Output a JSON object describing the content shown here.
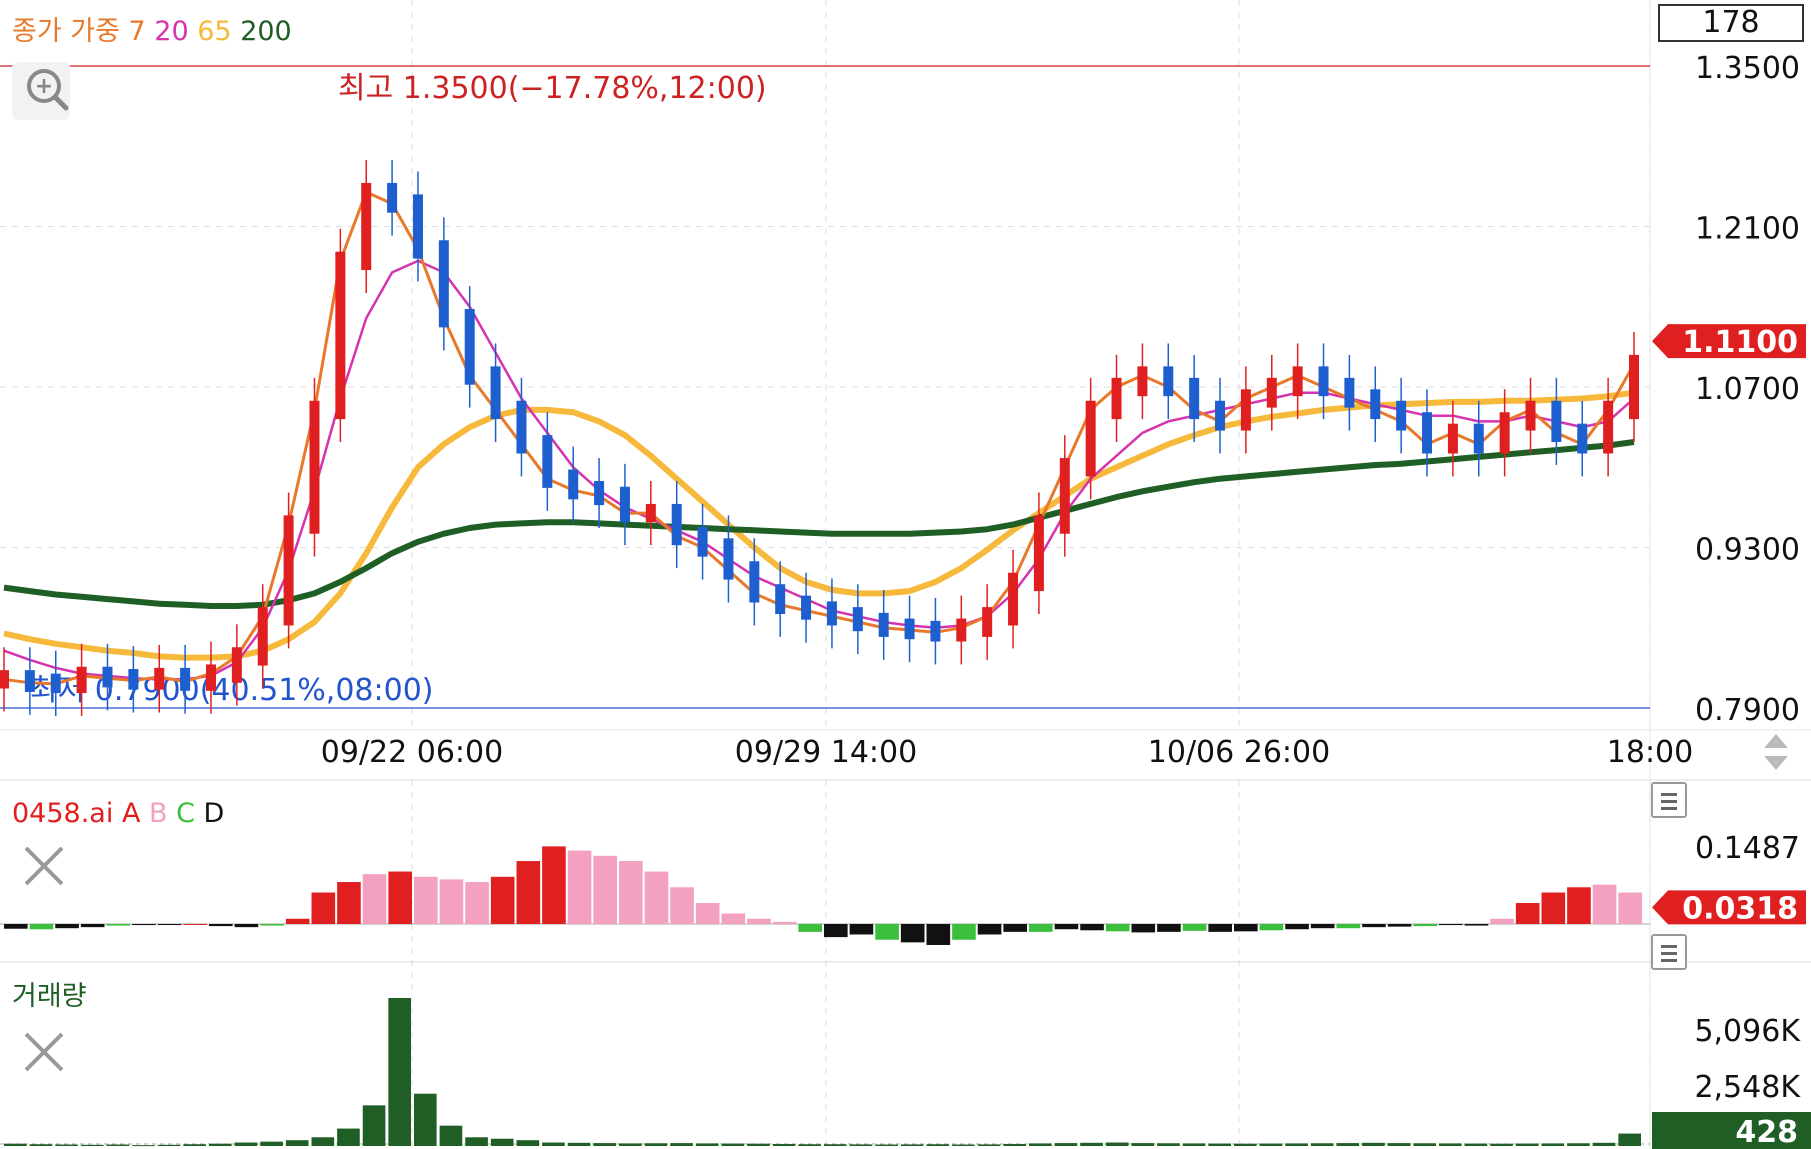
{
  "legend": {
    "prefix": "종가 가중",
    "ma": [
      {
        "label": "7",
        "color": "#e8792a"
      },
      {
        "label": "20",
        "color": "#d633b0"
      },
      {
        "label": "65",
        "color": "#f6b93b"
      },
      {
        "label": "200",
        "color": "#1f5e25"
      }
    ]
  },
  "counter": "178",
  "colors": {
    "up": "#e02020",
    "down": "#1e5fd0",
    "ma7": "#e8792a",
    "ma20": "#d633b0",
    "ma65": "#f6b93b",
    "ma200": "#1f5e25",
    "indicator_green": "#3cbf3c",
    "indicator_pink": "#f4a0c0",
    "volume": "#1f5e25"
  },
  "annotations": {
    "high": "최고 1.3500(−17.78%,12:00)",
    "low": "최저 0.7900(40.51%,08:00)"
  },
  "price_axis": [
    "1.3500",
    "1.2100",
    "1.0700",
    "0.9300",
    "0.7900"
  ],
  "current_price": "1.1100",
  "time_axis": [
    "09/22 06:00",
    "09/29 14:00",
    "10/06 26:00",
    "18:00"
  ],
  "indicator": {
    "name": "0458.ai",
    "lines": [
      {
        "label": "A",
        "color": "#e02020"
      },
      {
        "label": "B",
        "color": "#f4a0c0"
      },
      {
        "label": "C",
        "color": "#3cbf3c"
      },
      {
        "label": "D",
        "color": "#111111"
      }
    ],
    "axis": [
      "0.1487"
    ],
    "current": "0.0318"
  },
  "volume": {
    "title": "거래량",
    "axis": [
      "5,096K",
      "2,548K"
    ],
    "current": "428"
  },
  "chart_data": [
    {
      "type": "candlestick",
      "title": "",
      "ylim": [
        0.79,
        1.35
      ],
      "x_ticks": [
        "09/22 06:00",
        "09/29 14:00",
        "10/06 26:00",
        "18:00"
      ],
      "series": [
        {
          "name": "7",
          "type": "line",
          "values": [
            0.815,
            0.812,
            0.811,
            0.818,
            0.816,
            0.814,
            0.817,
            0.813,
            0.82,
            0.835,
            0.87,
            0.95,
            1.05,
            1.18,
            1.24,
            1.23,
            1.19,
            1.13,
            1.08,
            1.05,
            1.02,
            0.99,
            0.98,
            0.975,
            0.96,
            0.96,
            0.94,
            0.93,
            0.91,
            0.89,
            0.88,
            0.875,
            0.87,
            0.865,
            0.86,
            0.858,
            0.856,
            0.86,
            0.87,
            0.9,
            0.95,
            1.0,
            1.05,
            1.07,
            1.08,
            1.07,
            1.05,
            1.04,
            1.06,
            1.07,
            1.08,
            1.07,
            1.06,
            1.05,
            1.04,
            1.02,
            1.03,
            1.02,
            1.04,
            1.05,
            1.03,
            1.02,
            1.05,
            1.09
          ]
        },
        {
          "name": "20",
          "type": "line",
          "values": [
            0.84,
            0.832,
            0.825,
            0.82,
            0.818,
            0.816,
            0.815,
            0.815,
            0.818,
            0.83,
            0.86,
            0.91,
            0.98,
            1.06,
            1.13,
            1.17,
            1.18,
            1.17,
            1.14,
            1.1,
            1.06,
            1.03,
            1.0,
            0.98,
            0.965,
            0.955,
            0.945,
            0.935,
            0.92,
            0.905,
            0.895,
            0.885,
            0.875,
            0.87,
            0.865,
            0.862,
            0.86,
            0.862,
            0.87,
            0.89,
            0.92,
            0.96,
            0.99,
            1.01,
            1.03,
            1.04,
            1.045,
            1.05,
            1.055,
            1.06,
            1.065,
            1.065,
            1.06,
            1.055,
            1.05,
            1.045,
            1.045,
            1.04,
            1.04,
            1.045,
            1.04,
            1.035,
            1.04,
            1.06
          ]
        },
        {
          "name": "65",
          "type": "line",
          "values": [
            0.855,
            0.85,
            0.846,
            0.843,
            0.84,
            0.838,
            0.835,
            0.834,
            0.834,
            0.835,
            0.84,
            0.85,
            0.865,
            0.89,
            0.925,
            0.965,
            1.0,
            1.02,
            1.035,
            1.045,
            1.05,
            1.05,
            1.048,
            1.04,
            1.028,
            1.01,
            0.99,
            0.97,
            0.95,
            0.93,
            0.912,
            0.9,
            0.893,
            0.89,
            0.89,
            0.892,
            0.9,
            0.912,
            0.928,
            0.945,
            0.96,
            0.975,
            0.99,
            1.0,
            1.01,
            1.02,
            1.028,
            1.035,
            1.04,
            1.044,
            1.047,
            1.05,
            1.052,
            1.054,
            1.055,
            1.056,
            1.057,
            1.057,
            1.058,
            1.058,
            1.059,
            1.06,
            1.062,
            1.065
          ]
        },
        {
          "name": "200",
          "type": "line",
          "values": [
            0.895,
            0.892,
            0.889,
            0.887,
            0.885,
            0.883,
            0.881,
            0.88,
            0.879,
            0.879,
            0.88,
            0.884,
            0.89,
            0.9,
            0.912,
            0.925,
            0.935,
            0.942,
            0.947,
            0.95,
            0.951,
            0.952,
            0.952,
            0.951,
            0.95,
            0.949,
            0.948,
            0.947,
            0.946,
            0.945,
            0.944,
            0.943,
            0.942,
            0.942,
            0.942,
            0.942,
            0.943,
            0.944,
            0.946,
            0.95,
            0.956,
            0.962,
            0.968,
            0.974,
            0.979,
            0.983,
            0.987,
            0.99,
            0.992,
            0.994,
            0.996,
            0.998,
            1.0,
            1.002,
            1.003,
            1.005,
            1.007,
            1.009,
            1.011,
            1.013,
            1.015,
            1.017,
            1.019,
            1.022
          ]
        }
      ]
    },
    {
      "type": "bar",
      "title": "",
      "series": [
        {
          "name": "0458.ai",
          "values": [
            -0.009,
            -0.01,
            -0.008,
            -0.006,
            -0.003,
            -0.002,
            -0.001,
            0.0,
            -0.004,
            -0.006,
            -0.003,
            0.01,
            0.06,
            0.08,
            0.095,
            0.1,
            0.09,
            0.085,
            0.08,
            0.09,
            0.12,
            0.148,
            0.14,
            0.13,
            0.12,
            0.1,
            0.07,
            0.04,
            0.02,
            0.01,
            0.004,
            -0.015,
            -0.025,
            -0.02,
            -0.03,
            -0.035,
            -0.04,
            -0.03,
            -0.02,
            -0.015,
            -0.015,
            -0.01,
            -0.012,
            -0.014,
            -0.016,
            -0.015,
            -0.013,
            -0.015,
            -0.014,
            -0.012,
            -0.01,
            -0.008,
            -0.008,
            -0.006,
            -0.005,
            -0.004,
            -0.002,
            -0.003,
            0.01,
            0.04,
            0.06,
            0.07,
            0.075,
            0.06
          ]
        }
      ]
    },
    {
      "type": "bar",
      "title": "",
      "series": [
        {
          "name": "거래량",
          "values": [
            80,
            60,
            50,
            40,
            50,
            30,
            40,
            60,
            80,
            120,
            150,
            200,
            300,
            600,
            1400,
            5096,
            1800,
            700,
            300,
            250,
            200,
            120,
            110,
            100,
            90,
            95,
            100,
            90,
            85,
            80,
            70,
            60,
            60,
            55,
            50,
            55,
            60,
            50,
            55,
            70,
            90,
            100,
            110,
            120,
            100,
            95,
            90,
            85,
            80,
            85,
            90,
            95,
            100,
            110,
            100,
            95,
            90,
            85,
            80,
            85,
            90,
            95,
            110,
            428
          ]
        }
      ]
    }
  ]
}
